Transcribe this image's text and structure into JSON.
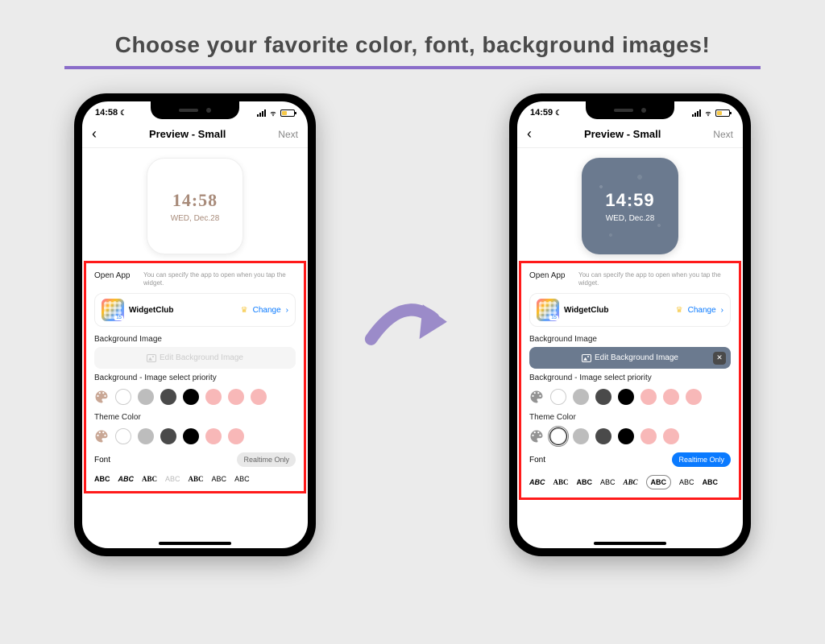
{
  "title": "Choose your favorite color, font, background images!",
  "phone_a": {
    "status_time": "14:58",
    "nav_title": "Preview - Small",
    "nav_next": "Next",
    "widget_time": "14:58",
    "widget_date": "WED, Dec.28",
    "open_app_label": "Open App",
    "open_app_hint": "You can specify the app to open when you tap the widget.",
    "app_name": "WidgetClub",
    "app_badge": "15",
    "change": "Change",
    "bg_image_label": "Background Image",
    "edit_bg": "Edit Background Image",
    "priority_label": "Background - Image select priority",
    "theme_label": "Theme Color",
    "font_label": "Font",
    "realtime": "Realtime Only",
    "fonts": [
      "ABC",
      "ABC",
      "ABC",
      "ABC",
      "ABC",
      "ABC",
      "ABC"
    ],
    "priority_swatches": [
      "#ffffff",
      "#bdbdbd",
      "#4a4a4a",
      "#000000",
      "#f8b8b8",
      "#f8b8b8",
      "#f8b8b8"
    ],
    "theme_swatches": [
      "#ffffff",
      "#bdbdbd",
      "#4a4a4a",
      "#000000",
      "#f8b8b8",
      "#f8b8b8"
    ]
  },
  "phone_b": {
    "status_time": "14:59",
    "nav_title": "Preview - Small",
    "nav_next": "Next",
    "widget_time": "14:59",
    "widget_date": "WED, Dec.28",
    "open_app_label": "Open App",
    "open_app_hint": "You can specify the app to open when you tap the widget.",
    "app_name": "WidgetClub",
    "app_badge": "15",
    "change": "Change",
    "bg_image_label": "Background Image",
    "edit_bg": "Edit Background Image",
    "priority_label": "Background - Image select priority",
    "theme_label": "Theme Color",
    "font_label": "Font",
    "realtime": "Realtime Only",
    "fonts": [
      "ABC",
      "ABC",
      "ABC",
      "ABC",
      "ABC",
      "ABC",
      "ABC",
      "ABC"
    ],
    "priority_swatches": [
      "#ffffff",
      "#bdbdbd",
      "#4a4a4a",
      "#000000",
      "#f8b8b8",
      "#f8b8b8",
      "#f8b8b8"
    ],
    "theme_swatches": [
      "#ffffff",
      "#bdbdbd",
      "#4a4a4a",
      "#000000",
      "#f8b8b8",
      "#f8b8b8"
    ]
  }
}
